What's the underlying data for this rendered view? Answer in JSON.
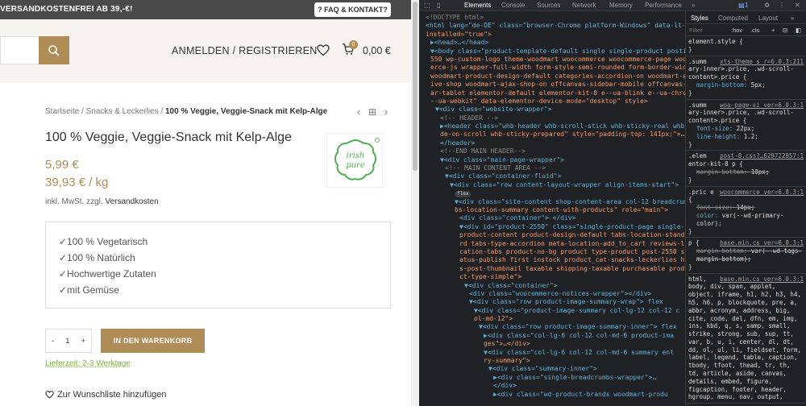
{
  "website": {
    "topbar": {
      "shipping_text": "VERSANDKOSTENFREI AB 39,-€!",
      "faq_label": "? FAQ & KONTAKT?"
    },
    "header": {
      "login_label": "ANMELDEN / REGISTRIEREN",
      "cart_count": "0",
      "cart_total": "0,00 €"
    },
    "breadcrumbs": {
      "items": [
        "Startseite",
        "Snacks & Leckerlies"
      ],
      "sep": "/",
      "current": "100 % Veggie, Veggie-Snack mit Kelp-Alge"
    },
    "product": {
      "title": "100 % Veggie, Veggie-Snack mit Kelp-Alge",
      "brand_logo_text": "irish pure",
      "price": "5,99 €",
      "unit_price": "39,93 € / kg",
      "tax_text": "inkl. MwSt. zzgl.",
      "shipping_link": "Versandkosten",
      "features": [
        "✓100 % Vegetarisch",
        "✓100 % Natürlich",
        "✓Hochwertige Zutaten",
        "✓mit Gemüse"
      ],
      "qty_minus": "-",
      "qty_value": "1",
      "qty_plus": "+",
      "add_to_cart": "IN DEN WARENKORB",
      "delivery": "Lieferzeit: 2-3 Werktage",
      "wishlist": "Zur Wunschliste hinzufügen"
    }
  },
  "devtools": {
    "tabs": [
      "Elements",
      "Console",
      "Sources",
      "Network",
      "Memory",
      "Performance"
    ],
    "more": "»",
    "issues_count": "1",
    "styles_tabs": [
      "Styles",
      "Computed",
      "Layout",
      "»"
    ],
    "filter_placeholder": "Filter",
    "filter_hov": ":hov",
    "filter_cls": ".cls",
    "dom_lines": [
      "<!DOCTYPE html>",
      "<html lang=\"de-DE\" class=\"browser-Chrome platform-Windows\" data-lt-",
      "installed=\"true\">",
      "▶<head>…</head>",
      "▼<body class=\"product-template-default single single-product postid-2",
      "550 wp-custom-logo theme-woodmart woocommerce woocommerce-page woocomm",
      "erce-js wrapper-full-width form-style-semi-rounded form-border-width-1",
      "woodmart-product-design-default categories-accordion-on woodmart-arch",
      "ive-shop woodmart-ajax-shop-on offcanvas-sidebar-mobile offcanvas-sideb",
      "ar-tablet elementor-default elementor-kit-8 e--ua-blink e--ua-chrome e",
      "--ua-webkit\" data-elementor-device-mode=\"desktop\" style>",
      "▼<div class=\"website-wrapper\">",
      "<!-- HEADER -->",
      "▶<header class=\"whb-header whb-scroll-stick whb-sticky-real whb-hi",
      "de-on-scroll whb-sticky-prepared\" style=\"padding-top: 141px;\">…",
      "</header>",
      "<!--END MAIN HEADER-->",
      "▼<div class=\"main-page-wrapper\">",
      "<!-- MAIN CONTENT AREA -->",
      "▼<div class=\"container-fluid\">",
      "▼<div class=\"row content-layout-wrapper align-items-start\">",
      "flex",
      "▼<div class=\"site-content shop-content-area col-12 breadcrum",
      "bs-location-summary content-with-products\" role=\"main\">",
      "<div class=\"container\"> </div>",
      "▼<div id=\"product-2550\" class=\"single-product-page single-",
      "product-content product-design-default tabs-location-standa",
      "rd tabs-type-accordion meta-location-add_to_cart reviews-lo",
      "cation-tabs product-no-bg product type-product post-2550 st",
      "atus-publish first instock product_cat-snacks-leckerlies ha",
      "s-post-thumbnail taxable shipping-taxable purchasable produ",
      "ct-type-simple\">",
      "▼<div class=\"container\">",
      "<div class=\"woocommerce-notices-wrapper\"></div>",
      "▼<div class=\"row product-image-summary-wrap\"> flex",
      "▼<div class=\"product-image-summary col-lg-12 col-12 c",
      "ol-md-12\">",
      "▼<div class=\"row product-image-summary-inner\"> flex",
      "▶<div class=\"col-lg-6 col-12 col-md-6 product-ima",
      "ges\">…</div>",
      "▼<div class=\"col-lg-6 col-12 col-md-6 summary ent",
      "ry-summary\">",
      "▼<div class=\"summary-inner\">",
      "▶<div class=\"single-breadcrumbs-wrapper\">…",
      "</div>",
      "▶<div class=\"wd-product-brands woodmart-produ"
    ],
    "style_rules": [
      {
        "selector": "element.style {",
        "source": "",
        "props": [],
        "close": "}"
      },
      {
        "selector": ".summ ary-inner>.price, .wd-scroll-content>.price {",
        "source": "xts-theme_s_r=6.0.3:211",
        "props": [
          [
            "margin-bottom",
            "5px;",
            false
          ]
        ],
        "close": "}"
      },
      {
        "selector": ".summ ary-inner>.price, .wd-scroll-content>.price {",
        "source": "woo-page-si_ver=6.0.3:1",
        "props": [
          [
            "font-size",
            "22px;",
            false
          ],
          [
            "line-height",
            "1.2;",
            false
          ]
        ],
        "close": "}"
      },
      {
        "selector": ".elem entor-kit-8 p {",
        "source": "post-8.css?…629722957:1",
        "props": [
          [
            "margin-bottom",
            "10px;",
            true
          ]
        ],
        "close": "}"
      },
      {
        "selector": ".pric e {",
        "source": "woocommerce_ver=6.0.3:1",
        "props": [
          [
            "font-size",
            "14px;",
            true
          ],
          [
            "color",
            "var(--wd-primary-color);",
            false
          ]
        ],
        "close": "}"
      },
      {
        "selector": "p {",
        "source": "base.min.cs_ver=6.0.3:1",
        "props": [
          [
            "margin-bottom",
            "var(--wd-tags-margin-bottom);",
            true
          ]
        ],
        "close": "}"
      },
      {
        "selector": "html, body, div, span, applet, object, iframe, h1, h2, h3, h4, h5, h6, p, blockquote, pre, a, abbr, acronym, address, big, cite, code, del, dfn, em, img, ins, kbd, q, s, samp, small, strike, strong, sub, sup, tt, var, b, u, i, center, dl, dt, dd, ol, ul, li, fieldset, form, label, legend, table, caption, tbody, tfoot, thead, tr, th, td, article, aside, canvas, details, embed, figure, figcaption, footer, header, hgroup, menu, nav, output,",
        "source": "base.min.cs_ver=6.0.3:1",
        "props": [],
        "close": ""
      }
    ]
  }
}
